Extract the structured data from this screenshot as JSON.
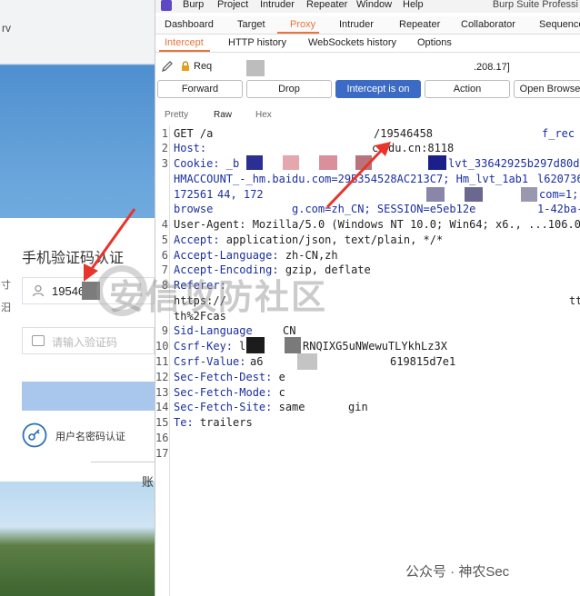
{
  "login": {
    "top_text": "rv",
    "title": "手机验证码认证",
    "side_chars": [
      "寸",
      "汨"
    ],
    "phone_value": "19546",
    "code_placeholder": "请输入验证码",
    "alt_login": "用户名密码认证",
    "account_label": "账"
  },
  "burp": {
    "menu": [
      "Burp",
      "Project",
      "Intruder",
      "Repeater",
      "Window",
      "Help"
    ],
    "title": "Burp Suite Professi",
    "tabs": [
      "Dashboard",
      "Target",
      "Proxy",
      "Intruder",
      "Repeater",
      "Collaborator",
      "Sequence"
    ],
    "active_tab": "Proxy",
    "subtabs": [
      "Intercept",
      "HTTP history",
      "WebSockets history",
      "Options"
    ],
    "active_subtab": "Intercept",
    "request_label": "Req",
    "request_ip": ".208.17]",
    "buttons": {
      "forward": "Forward",
      "drop": "Drop",
      "intercept": "Intercept is on",
      "action": "Action",
      "open_browser": "Open Browse"
    },
    "view_tabs": [
      "Pretty",
      "Raw",
      "Hex"
    ],
    "active_view": "Raw",
    "line_numbers": [
      "1",
      "2",
      "3",
      "",
      "",
      "",
      "4",
      "5",
      "6",
      "7",
      "8",
      "",
      "",
      "9",
      "10",
      "11",
      "12",
      "13",
      "14",
      "15",
      "16",
      "17"
    ],
    "lines": {
      "l1a": "GET /a",
      "l1b": "/19546458",
      "l1c": "f_rec",
      "l2a": "Host: ",
      "l2b": "c",
      "l2c": "du.cn:8118",
      "l3a": "Cookie: _b",
      "l3b": "lvt_33642925b297d80d2",
      "l3c": "HMACCOUNT_-_hm.baidu.com=29B354528AC213C7; Hm_lvt_1ab1",
      "l3d": "l620736e",
      "l3e": "172561",
      "l3f": "44, 172",
      "l3g": "com=1;",
      "l3h": "browse",
      "l3i": "g.com=zh_CN; SESSION=e5eb12e",
      "l3j": "1-42ba-9",
      "l4": "User-Agent: Mozilla/5.0 (Windows NT 10.0; Win64; x6., ...106.0)",
      "l5k": "Accept: ",
      "l5v": "application/json, text/plain, */*",
      "l6k": "Accept-Language: ",
      "l6v": "zh-CN,zh",
      "l7k": "Accept-Encoding: ",
      "l7v": "gzip, deflate",
      "l8a": "Referer:",
      "l8b": "https://",
      "l8c": "tt",
      "l8d": "th%2Fcas",
      "l9a": "Sid-Language",
      "l9b": "CN",
      "l10a": "Csrf-Key: ",
      "l10b": "l",
      "l10c": "RNQIXG5uNWewuTLYkhLz3X",
      "l11a": "Csrf-Value: ",
      "l11b": "a6",
      "l11c": "619815d7e1",
      "l12a": "Sec-Fetch-Dest: ",
      "l12b": "e",
      "l13a": "Sec-Fetch-Mode: ",
      "l13b": "c",
      "l14a": "Sec-Fetch-Site: ",
      "l14b": "same",
      "l14c": "gin",
      "l15k": "Te: ",
      "l15v": "trailers"
    }
  },
  "watermark": "安信攻防社区",
  "footer": "公众号 · 神农Sec",
  "colors": {
    "accent": "#e8743b",
    "intercept_btn": "#3c6bc5",
    "arrow": "#e8352b",
    "key_blue": "#1a2fa0"
  }
}
